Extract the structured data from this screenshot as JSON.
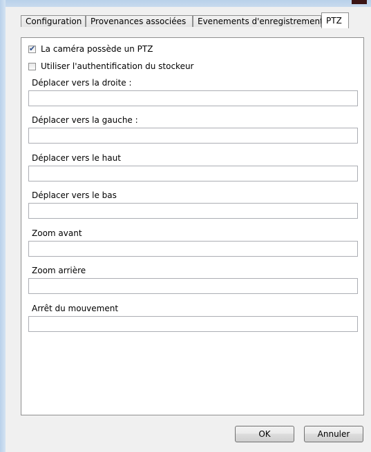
{
  "tabs": [
    {
      "label": "Configuration"
    },
    {
      "label": "Provenances associées"
    },
    {
      "label": "Evenements d'enregistrement"
    },
    {
      "label": "PTZ"
    }
  ],
  "active_tab": "PTZ",
  "checkboxes": [
    {
      "label": "La caméra possède un PTZ",
      "checked": true
    },
    {
      "label": "Utiliser l'authentification du stockeur",
      "checked": false
    }
  ],
  "fields": [
    {
      "label": "Déplacer vers la droite :",
      "value": ""
    },
    {
      "label": "Déplacer vers la gauche :",
      "value": ""
    },
    {
      "label": "Déplacer vers le haut",
      "value": ""
    },
    {
      "label": "Déplacer vers le bas",
      "value": ""
    },
    {
      "label": "Zoom avant",
      "value": ""
    },
    {
      "label": "Zoom arrière",
      "value": ""
    },
    {
      "label": "Arrêt du mouvement",
      "value": ""
    }
  ],
  "buttons": {
    "ok_label": "OK",
    "cancel_label": "Annuler"
  }
}
